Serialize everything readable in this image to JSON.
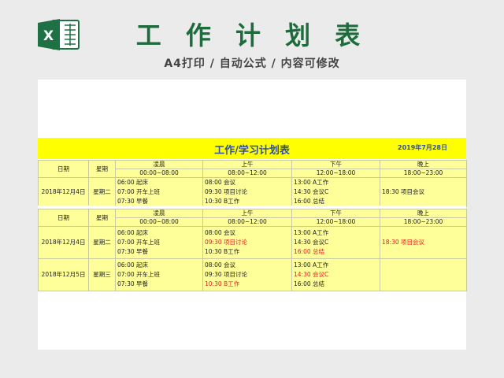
{
  "header": {
    "title": "工 作 计 划 表",
    "subtitle": "A4打印 / 自动公式 / 内容可修改",
    "logo_icon": "excel-icon",
    "brand_color": "#1e6b3c"
  },
  "sheet": {
    "banner_title": "工作/学习计划表",
    "banner_date": "2019年7月28日",
    "colors": {
      "banner": "#ffff00",
      "table_fill": "#ffff99",
      "highlight": "#e02020"
    }
  },
  "table1": {
    "headers": {
      "date": "日期",
      "weekday": "星期",
      "periods": [
        "凌晨",
        "上午",
        "下午",
        "晚上"
      ],
      "times": [
        "00:00~08:00",
        "08:00~12:00",
        "12:00~18:00",
        "18:00~23:00"
      ]
    },
    "row": {
      "date": "2018年12月4日",
      "weekday": "星期二",
      "c1": [
        "06:00  起床",
        "07:00  开车上班",
        "07:30  早餐"
      ],
      "c2": [
        "08:00  会议",
        "09:30  项目讨论",
        "10:30  B工作"
      ],
      "c3": [
        "13:00  A工作",
        "14:30  会议C",
        "16:00  总结"
      ],
      "c4": [
        "18:30  项目会议"
      ]
    }
  },
  "table2": {
    "headers": {
      "date": "日期",
      "weekday": "星期",
      "periods": [
        "凌晨",
        "上午",
        "下午",
        "晚上"
      ],
      "times": [
        "00:00~08:00",
        "08:00~12:00",
        "12:00~18:00",
        "18:00~23:00"
      ]
    },
    "row1": {
      "date": "2018年12月4日",
      "weekday": "星期二",
      "c1": [
        "06:00  起床",
        "07:00  开车上班",
        "07:30  早餐"
      ],
      "c2": [
        "08:00  会议",
        "09:30  项目讨论",
        "10:30  B工作"
      ],
      "c3": [
        "13:00  A工作",
        "14:30  会议C",
        "16:00  总结"
      ],
      "c4": [
        "18:30  项目会议"
      ]
    },
    "row2": {
      "date": "2018年12月5日",
      "weekday": "星期三",
      "c1": [
        "06:00  起床",
        "07:00  开车上班",
        "07:30  早餐"
      ],
      "c2": [
        "08:00  会议",
        "09:30  项目讨论",
        "10:30  B工作"
      ],
      "c3": [
        "13:00  A工作",
        "14:30  会议C",
        "16:00  总结"
      ],
      "c4": []
    }
  }
}
